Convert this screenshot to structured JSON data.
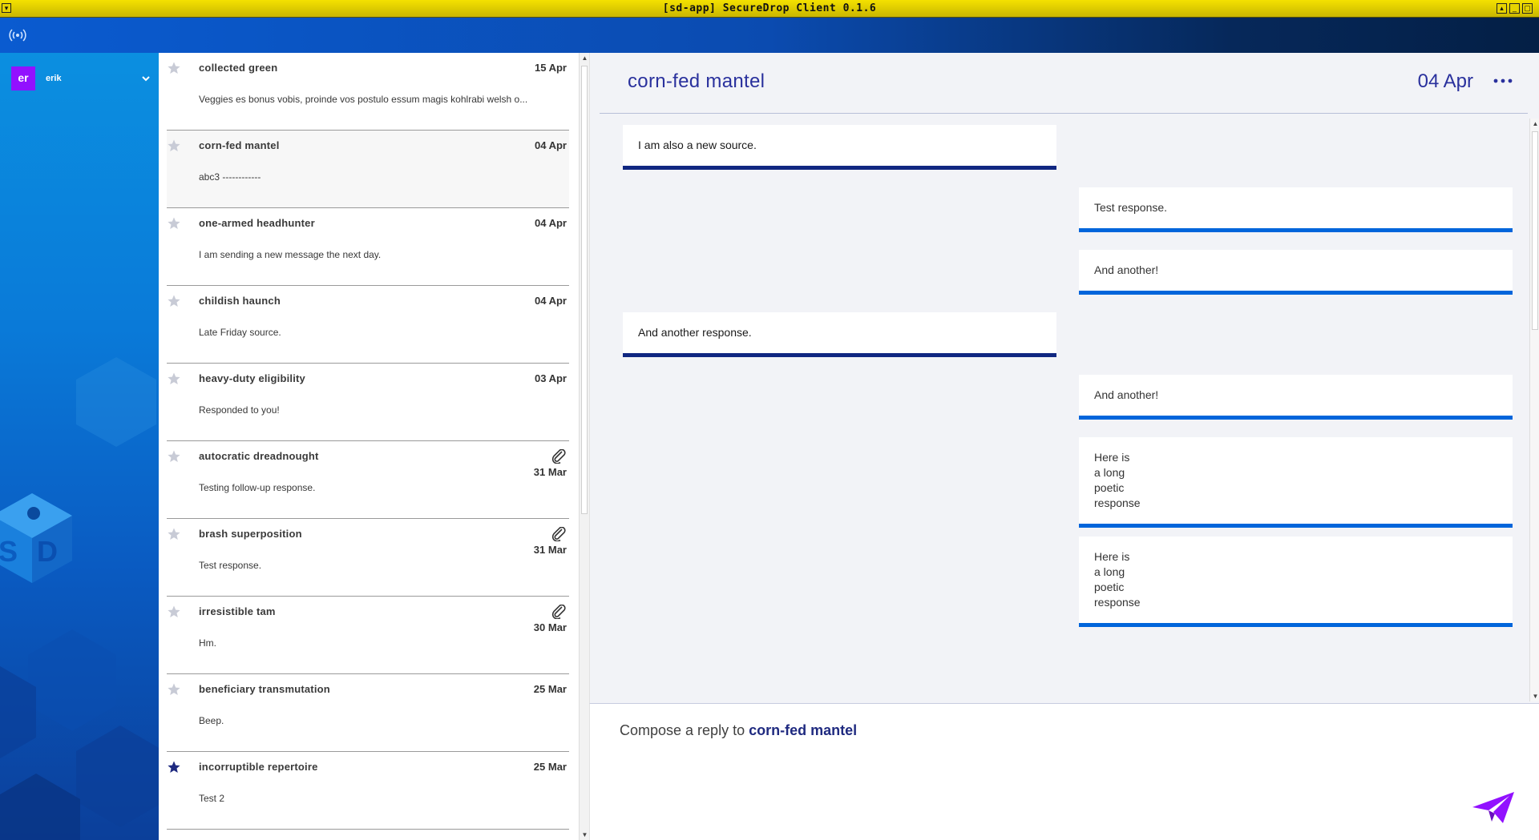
{
  "window": {
    "title": "[sd-app] SecureDrop Client 0.1.6"
  },
  "user": {
    "initials": "er",
    "name": "erik"
  },
  "sources": [
    {
      "name": "collected green",
      "date": "15 Apr",
      "preview": "Veggies es bonus vobis, proinde vos postulo essum magis kohlrabi welsh o...",
      "starred": false,
      "attachment": false,
      "selected": false
    },
    {
      "name": "corn-fed mantel",
      "date": "04 Apr",
      "preview": "abc3 ------------",
      "starred": false,
      "attachment": false,
      "selected": true
    },
    {
      "name": "one-armed headhunter",
      "date": "04 Apr",
      "preview": "I am sending a new message the next day.",
      "starred": false,
      "attachment": false,
      "selected": false
    },
    {
      "name": "childish haunch",
      "date": "04 Apr",
      "preview": "Late Friday source.",
      "starred": false,
      "attachment": false,
      "selected": false
    },
    {
      "name": "heavy-duty eligibility",
      "date": "03 Apr",
      "preview": "Responded to you!",
      "starred": false,
      "attachment": false,
      "selected": false
    },
    {
      "name": "autocratic dreadnought",
      "date": "31 Mar",
      "preview": "Testing follow-up response.",
      "starred": false,
      "attachment": true,
      "selected": false
    },
    {
      "name": "brash superposition",
      "date": "31 Mar",
      "preview": "Test response.",
      "starred": false,
      "attachment": true,
      "selected": false
    },
    {
      "name": "irresistible tam",
      "date": "30 Mar",
      "preview": "Hm.",
      "starred": false,
      "attachment": true,
      "selected": false
    },
    {
      "name": "beneficiary transmutation",
      "date": "25 Mar",
      "preview": "Beep.",
      "starred": false,
      "attachment": false,
      "selected": false
    },
    {
      "name": "incorruptible repertoire",
      "date": "25 Mar",
      "preview": "Test 2",
      "starred": true,
      "attachment": false,
      "selected": false
    }
  ],
  "conversation": {
    "source_name": "corn-fed mantel",
    "date": "04 Apr",
    "messages": [
      {
        "kind": "source",
        "text": "I am also a new source."
      },
      {
        "kind": "reply",
        "text": "Test response."
      },
      {
        "kind": "reply",
        "text": "And another!"
      },
      {
        "kind": "source",
        "text": "And another response."
      },
      {
        "kind": "reply",
        "text": "And another!"
      },
      {
        "kind": "reply",
        "text": "Here is\na long\npoetic\nresponse"
      },
      {
        "kind": "reply",
        "text": "Here is\na long\npoetic\nresponse"
      }
    ]
  },
  "reply": {
    "placeholder_prefix": "Compose a reply to",
    "placeholder_name": "corn-fed mantel"
  },
  "icons": {
    "sync": "sync-signal-icon",
    "star": "star-icon",
    "attachment": "paperclip-icon",
    "send": "send-paper-plane-icon",
    "menu": "more-options-icon"
  },
  "colors": {
    "accent": "#2a319d",
    "source_bubble_border": "#102781",
    "reply_bubble_border": "#0065db",
    "avatar": "#9211ff",
    "send": "#9211ff"
  }
}
